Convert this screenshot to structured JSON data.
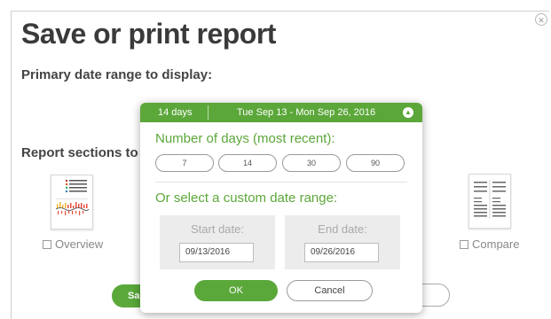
{
  "page": {
    "title": "Save or print report",
    "primary_label": "Primary date range to display:",
    "sections_label": "Report sections to d",
    "close_icon": "close-icon"
  },
  "sections": {
    "overview": {
      "label": "Overview",
      "checked": false
    },
    "compare": {
      "label": "Compare",
      "checked": false
    }
  },
  "background_buttons": {
    "save_label": "Sa"
  },
  "popup": {
    "header_days": "14 days",
    "header_range": "Tue Sep 13 - Mon Sep 26, 2016",
    "collapse_icon": "chevron-up-icon",
    "days_heading": "Number of days (most recent):",
    "day_options": [
      "7",
      "14",
      "30",
      "90"
    ],
    "custom_heading": "Or select a custom date range:",
    "start_label": "Start date:",
    "start_value": "09/13/2016",
    "end_label": "End date:",
    "end_value": "09/26/2016",
    "ok_label": "OK",
    "cancel_label": "Cancel"
  },
  "colors": {
    "accent_green": "#5ca73a",
    "panel_gray": "#ececec"
  }
}
